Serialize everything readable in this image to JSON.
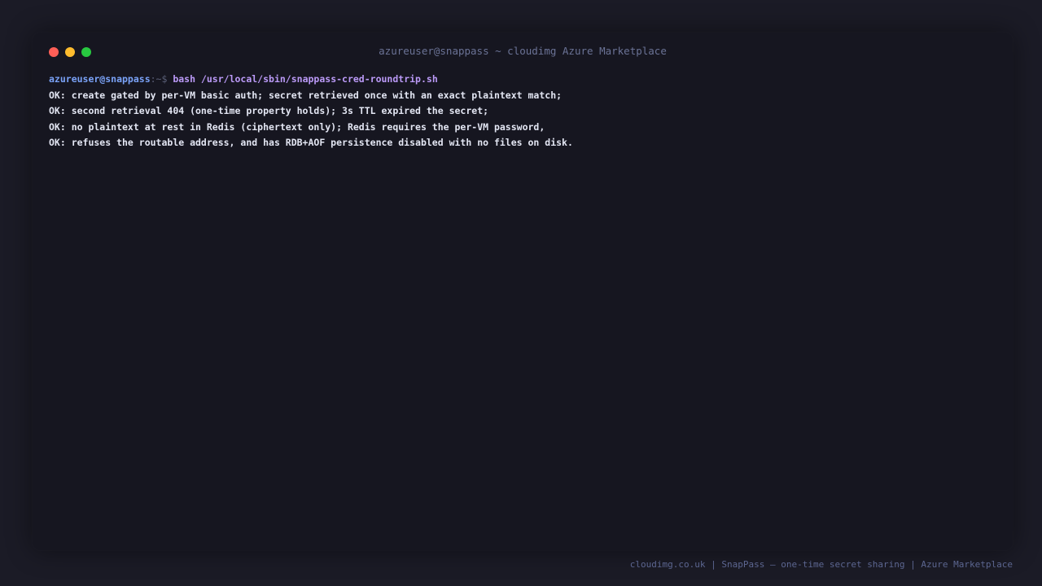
{
  "window": {
    "title": "azureuser@snappass ~ cloudimg Azure Marketplace"
  },
  "terminal": {
    "prompt": {
      "user_host": "azureuser@snappass",
      "path_symbol": ":~$ ",
      "command": "bash /usr/local/sbin/snappass-cred-roundtrip.sh"
    },
    "output": [
      "OK: create gated by per-VM basic auth; secret retrieved once with an exact plaintext match;",
      "OK: second retrieval 404 (one-time property holds); 3s TTL expired the secret;",
      "OK: no plaintext at rest in Redis (ciphertext only); Redis requires the per-VM password,",
      "OK: refuses the routable address, and has RDB+AOF persistence disabled with no files on disk."
    ]
  },
  "footer": {
    "text": "cloudimg.co.uk | SnapPass — one-time secret sharing | Azure Marketplace"
  },
  "colors": {
    "background": "#1b1b26",
    "terminal_bg": "#161620",
    "prompt_user": "#7aa2f7",
    "command": "#bb9af7",
    "output_text": "#e3e6f3",
    "close": "#ff5f57",
    "minimize": "#febc2e",
    "maximize": "#28c840"
  }
}
